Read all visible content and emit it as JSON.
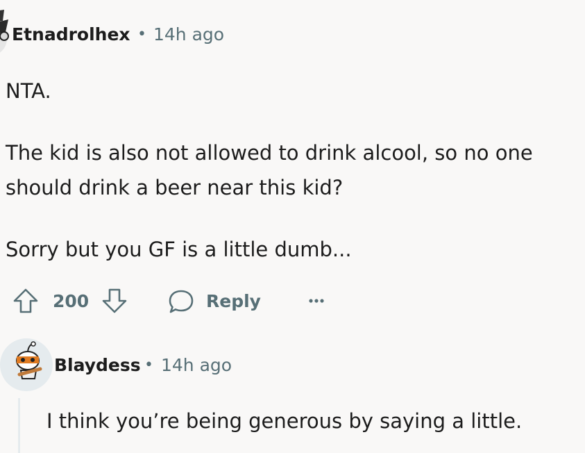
{
  "comment": {
    "author": "Etnadrolhex",
    "separator": "•",
    "time": "14h ago",
    "paragraphs": [
      "NTA.",
      "The kid is also not allowed to drink alcool, so no one",
      "should drink a beer near this kid?",
      "Sorry but you GF is a little dumb..."
    ],
    "score": "200",
    "reply_label": "Reply",
    "icons": [
      "upvote-icon",
      "downvote-icon",
      "speech-bubble-icon",
      "more-options-icon"
    ]
  },
  "reply": {
    "author": "Blaydess",
    "separator": "•",
    "time": "14h ago",
    "text": "I think you’re being generous by saying a little."
  },
  "colors": {
    "background": "#f9f8f7",
    "text": "#1c1c1c",
    "meta": "#576f76",
    "thread_line": "#e5ebee"
  }
}
